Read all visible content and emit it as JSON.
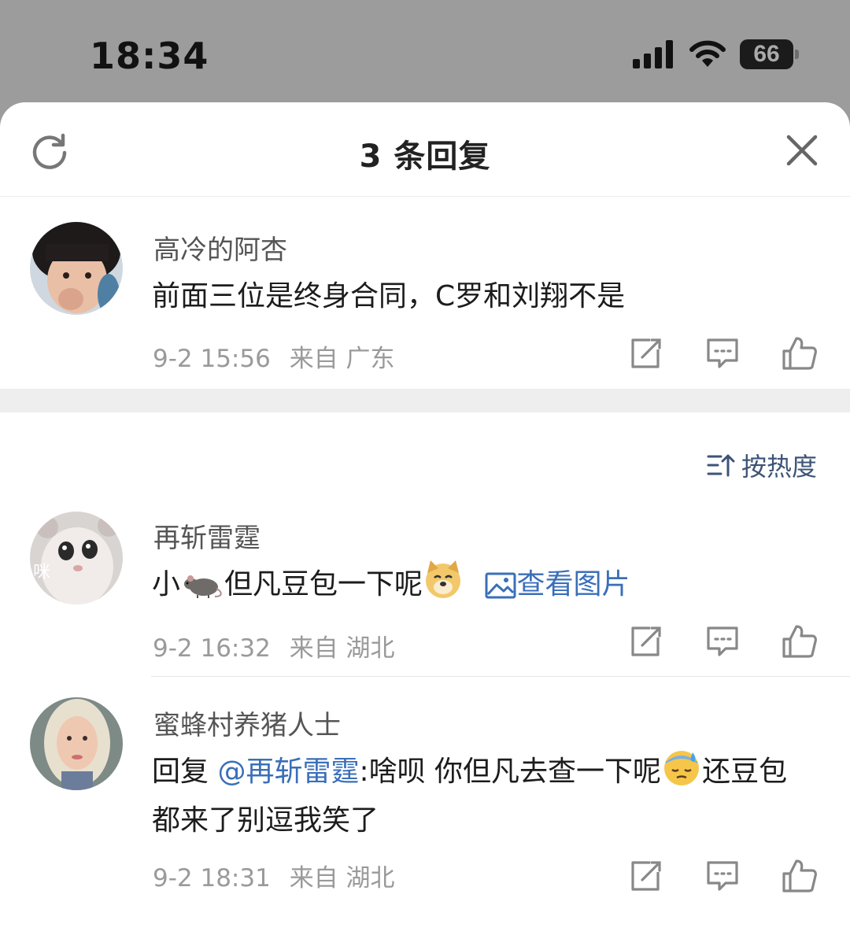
{
  "status_bar": {
    "time": "18:34",
    "battery": "66"
  },
  "header": {
    "title": "3 条回复"
  },
  "comments": [
    {
      "username": "高冷的阿杏",
      "text": "前面三位是终身合同，C罗和刘翔不是",
      "date": "9-2 15:56",
      "location": "来自 广东"
    },
    {
      "username": "再斩雷霆",
      "text_before": "小",
      "text_after": "但凡豆包一下呢",
      "view_image": "查看图片",
      "avatar_label": "咪",
      "date": "9-2 16:32",
      "location": "来自 湖北"
    },
    {
      "username": "蜜蜂村养猪人士",
      "reply_prefix": "回复",
      "mention": "@再斩雷霆",
      "text_part1": ":啥呗 你但凡去查一下呢",
      "text_part2": "还豆包都来了别逗我笑了",
      "date": "9-2 18:31",
      "location": "来自 湖北"
    }
  ],
  "sort": {
    "label": "按热度"
  },
  "icons": [
    "refresh-icon",
    "close-icon",
    "share-icon",
    "comment-icon",
    "like-icon",
    "sort-icon",
    "image-icon"
  ],
  "colors": {
    "link": "#3a6fb8",
    "sort": "#3d5478",
    "meta": "#9a9a9a"
  }
}
